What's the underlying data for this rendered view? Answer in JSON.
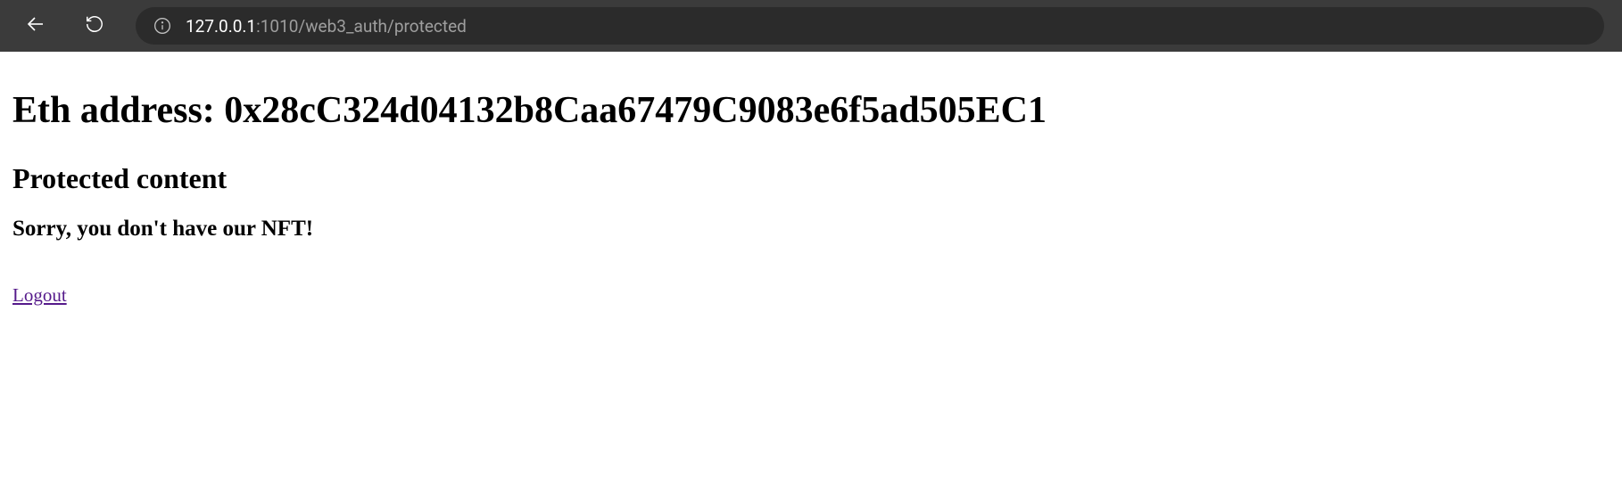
{
  "browser": {
    "url_host": "127.0.0.1",
    "url_path": ":1010/web3_auth/protected"
  },
  "page": {
    "heading1": "Eth address: 0x28cC324d04132b8Caa67479C9083e6f5ad505EC1",
    "heading2": "Protected content",
    "heading3": "Sorry, you don't have our NFT!",
    "logout_label": "Logout"
  }
}
